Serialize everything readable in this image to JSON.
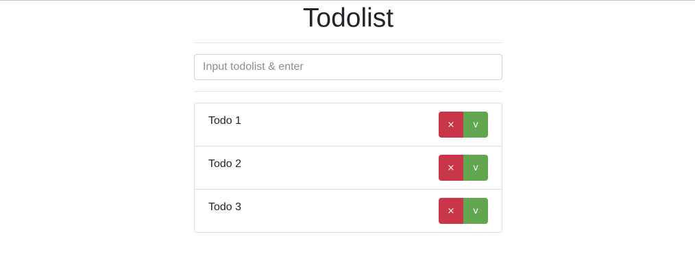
{
  "app": {
    "title": "Todolist"
  },
  "input": {
    "placeholder": "Input todolist & enter",
    "value": ""
  },
  "todos": [
    {
      "text": "Todo 1",
      "delete_icon": "×",
      "done_icon": "v"
    },
    {
      "text": "Todo 2",
      "delete_icon": "×",
      "done_icon": "v"
    },
    {
      "text": "Todo 3",
      "delete_icon": "×",
      "done_icon": "v"
    }
  ],
  "colors": {
    "delete": "#c9364a",
    "done": "#62a74f",
    "border": "#dfdfdf"
  }
}
